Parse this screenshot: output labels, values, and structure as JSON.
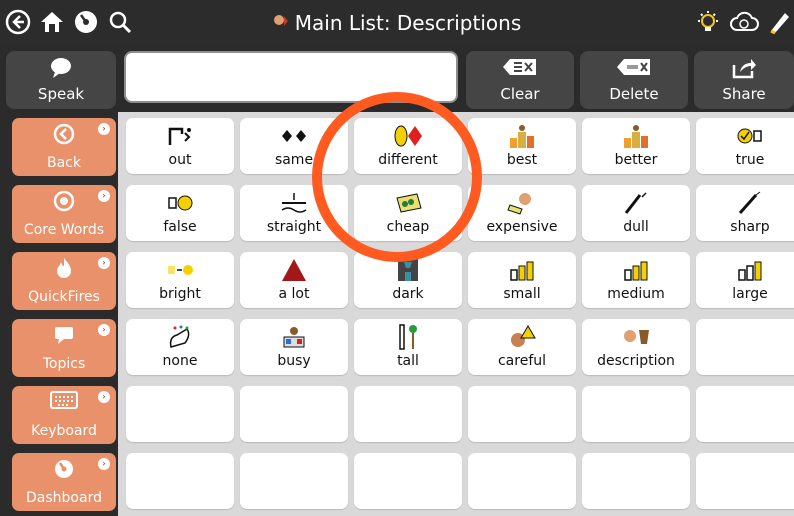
{
  "header": {
    "title": "Main List: Descriptions"
  },
  "toolbar": {
    "speak": "Speak",
    "clear": "Clear",
    "delete": "Delete",
    "share": "Share",
    "message": ""
  },
  "sidebar": {
    "items": [
      "Back",
      "Core Words",
      "QuickFires",
      "Topics",
      "Keyboard",
      "Dashboard"
    ]
  },
  "grid": {
    "rows": [
      [
        "out",
        "same",
        "different",
        "best",
        "better",
        "true"
      ],
      [
        "false",
        "straight",
        "cheap",
        "expensive",
        "dull",
        "sharp"
      ],
      [
        "bright",
        "a lot",
        "dark",
        "small",
        "medium",
        "large"
      ],
      [
        "none",
        "busy",
        "tall",
        "careful",
        "description",
        ""
      ],
      [
        "",
        "",
        "",
        "",
        "",
        ""
      ],
      [
        "",
        "",
        "",
        "",
        "",
        ""
      ]
    ]
  },
  "colors": {
    "sidebar": "#e8916a",
    "highlight": "#ff5a1f",
    "background": "#2b2b2b"
  }
}
